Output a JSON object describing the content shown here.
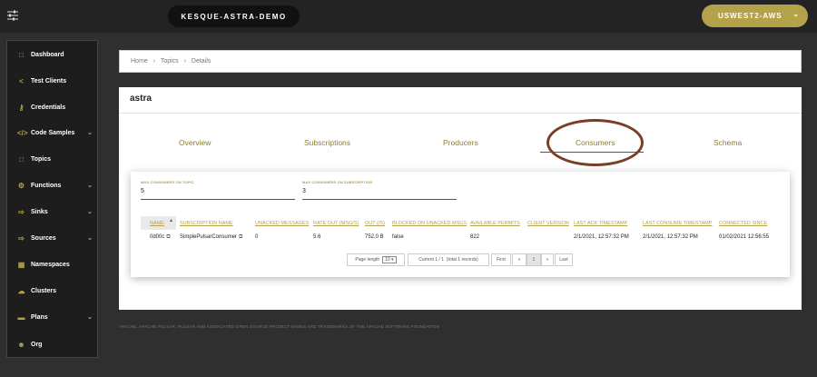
{
  "header": {
    "cluster_name": "KESQUE-ASTRA-DEMO",
    "region": "USWEST2-AWS"
  },
  "sidebar": {
    "items": [
      {
        "label": "Dashboard",
        "icon": "monitor-icon",
        "expandable": false
      },
      {
        "label": "Test Clients",
        "icon": "share-icon",
        "expandable": false
      },
      {
        "label": "Credentials",
        "icon": "key-icon",
        "expandable": false
      },
      {
        "label": "Code Samples",
        "icon": "code-icon",
        "expandable": true
      },
      {
        "label": "Topics",
        "icon": "folder-icon",
        "expandable": false
      },
      {
        "label": "Functions",
        "icon": "cogs-icon",
        "expandable": true
      },
      {
        "label": "Sinks",
        "icon": "sink-icon",
        "expandable": true
      },
      {
        "label": "Sources",
        "icon": "source-icon",
        "expandable": true
      },
      {
        "label": "Namespaces",
        "icon": "table-icon",
        "expandable": false
      },
      {
        "label": "Clusters",
        "icon": "cloud-icon",
        "expandable": false
      },
      {
        "label": "Plans",
        "icon": "credit-card-icon",
        "expandable": true
      },
      {
        "label": "Org",
        "icon": "users-icon",
        "expandable": false
      }
    ]
  },
  "breadcrumb": {
    "items": [
      "Home",
      "Topics",
      "Details"
    ],
    "separator": "›"
  },
  "topic": {
    "title": "astra"
  },
  "tabs": [
    "Overview",
    "Subscriptions",
    "Producers",
    "Consumers",
    "Schema"
  ],
  "active_tab": "Consumers",
  "limits": {
    "max_consumers_topic_label": "MAX CONSUMERS ON TOPIC",
    "max_consumers_topic_value": "5",
    "max_consumers_subscription_label": "MAX CONSUMERS ON SUBSCRIPTION",
    "max_consumers_subscription_value": "3"
  },
  "table": {
    "columns": [
      "NAME",
      "SUBSCRIPTION NAME",
      "UNACKED MESSAGES",
      "RATE OUT (MSG/S)",
      "OUT (/S)",
      "BLOCKED ON UNACKED MSGS",
      "AVAILABLE PERMITS",
      "CLIENT VERSION",
      "LAST ACK TIMESTAMP",
      "LAST CONSUME TIMESTAMP",
      "CONNECTED SINCE"
    ],
    "rows": [
      [
        "0d00c",
        "SimplePulsarConsumer",
        "0",
        "5.6",
        "752.0 B",
        "false",
        "822",
        "",
        "2/1/2021, 12:57:32 PM",
        "2/1/2021, 12:57:32 PM",
        "01/02/2021 12:56:55"
      ]
    ]
  },
  "pagination": {
    "page_length_label": "Page length",
    "page_length_value": "10",
    "current_label": "Current 1 / 1",
    "total_label": "(total 1 records)",
    "first": "First",
    "prev": "«",
    "page": "1",
    "next": "»",
    "last": "Last"
  },
  "footer": {
    "text": "APACHE, APACHE PULSAR, PULSAR AND ASSOCIATED OPEN SOURCE PROJECT NAMES ARE TRADEMARKS OF THE APACHE SOFTWARE FOUNDATION"
  },
  "colors": {
    "accent": "#b3a24a",
    "highlight_annotation": "#7a3e22"
  }
}
